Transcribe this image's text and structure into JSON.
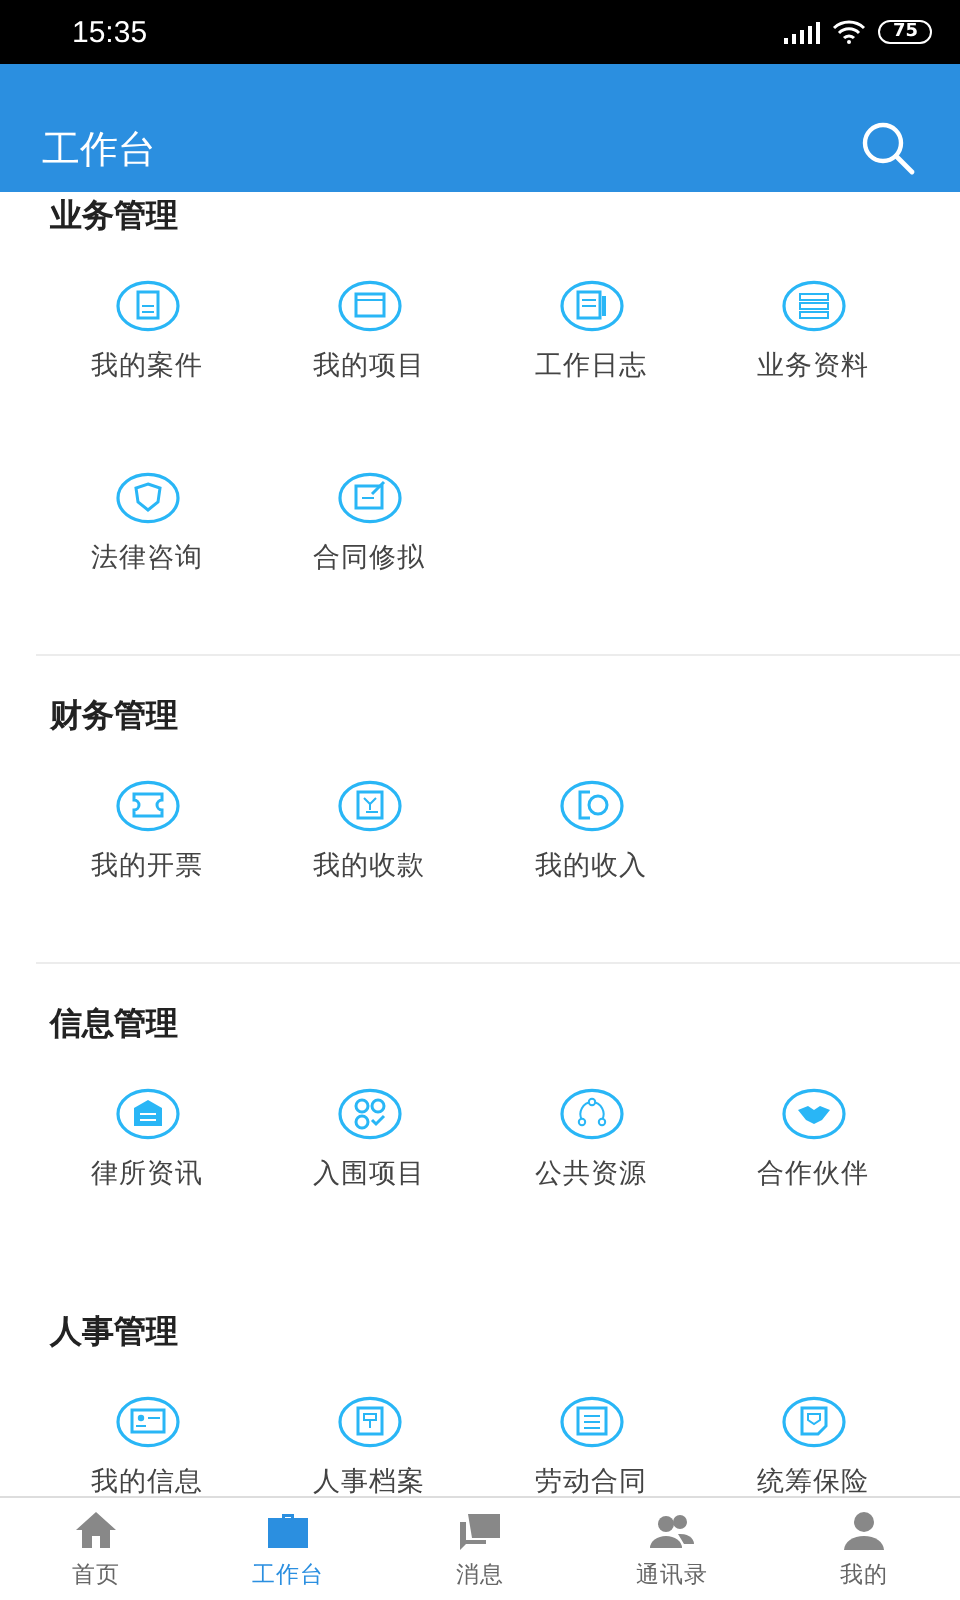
{
  "status_bar": {
    "time": "15:35",
    "battery": "75"
  },
  "header": {
    "title": "工作台"
  },
  "sections": [
    {
      "title": "业务管理",
      "divider": true,
      "items": [
        {
          "label": "我的案件"
        },
        {
          "label": "我的项目"
        },
        {
          "label": "工作日志"
        },
        {
          "label": "业务资料"
        },
        {
          "label": "法律咨询"
        },
        {
          "label": "合同修拟"
        }
      ]
    },
    {
      "title": "财务管理",
      "divider": true,
      "items": [
        {
          "label": "我的开票"
        },
        {
          "label": "我的收款"
        },
        {
          "label": "我的收入"
        }
      ]
    },
    {
      "title": "信息管理",
      "divider": false,
      "items": [
        {
          "label": "律所资讯"
        },
        {
          "label": "入围项目"
        },
        {
          "label": "公共资源"
        },
        {
          "label": "合作伙伴"
        }
      ]
    },
    {
      "title": "人事管理",
      "items": [
        {
          "label": "我的信息"
        },
        {
          "label": "人事档案"
        },
        {
          "label": "劳动合同"
        },
        {
          "label": "统筹保险"
        }
      ]
    }
  ],
  "tab_bar": [
    {
      "label": "首页",
      "selected": false
    },
    {
      "label": "工作台",
      "selected": true
    },
    {
      "label": "消息",
      "selected": false
    },
    {
      "label": "通讯录",
      "selected": false
    },
    {
      "label": "我的",
      "selected": false
    }
  ]
}
